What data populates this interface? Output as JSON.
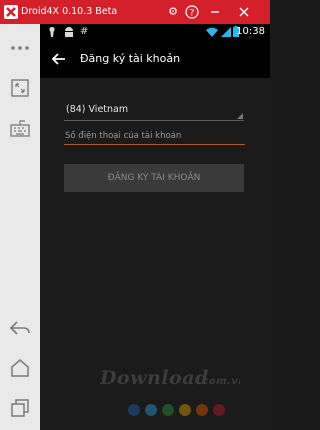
{
  "window": {
    "title": "Droid4X 0.10.3 Beta",
    "buttons": [
      {
        "name": "settings-icon",
        "glyph": "⚙"
      },
      {
        "name": "help-icon",
        "glyph": "?"
      },
      {
        "name": "minimize-icon",
        "glyph": "—"
      },
      {
        "name": "close-icon",
        "glyph": "✕"
      }
    ]
  },
  "statusbar": {
    "time": "10:38"
  },
  "actionbar": {
    "title": "Đăng ký tài khoản"
  },
  "form": {
    "country_value": "(84) Vietnam",
    "phone_placeholder": "Số điện thoại của tài khoản",
    "register_label": "ĐĂNG KÝ TÀI KHOẢN"
  },
  "watermark": {
    "text": "Download.com.vn",
    "dot_colors": [
      "#1e63b8",
      "#2a9bd6",
      "#2a8f3d",
      "#d4a400",
      "#d45a00",
      "#c0182a"
    ]
  },
  "colors": {
    "titlebar": "#d4202a",
    "input_underline": "#b15a2c"
  }
}
